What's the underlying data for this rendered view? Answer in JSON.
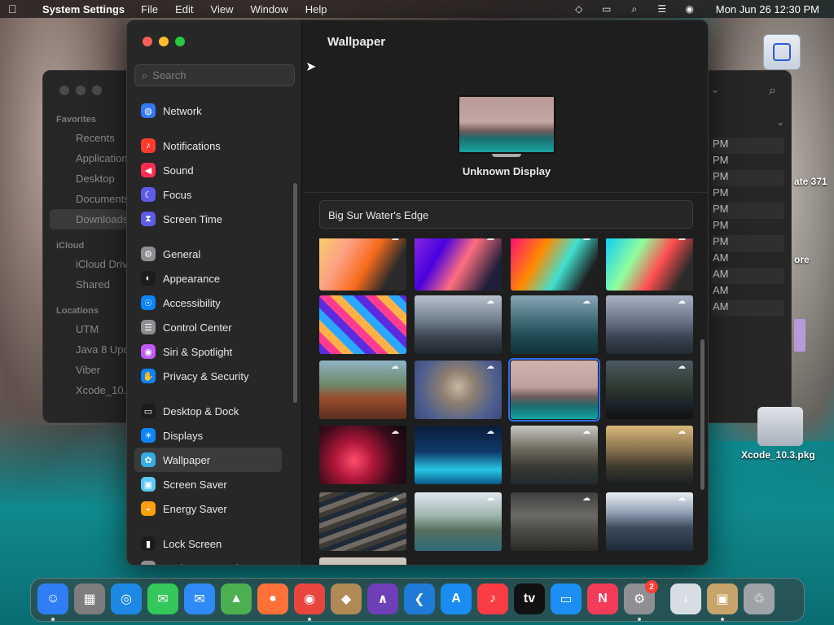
{
  "menubar": {
    "app_name": "System Settings",
    "menus": [
      "File",
      "Edit",
      "View",
      "Window",
      "Help"
    ],
    "clock": "Mon Jun 26  12:30 PM"
  },
  "finder": {
    "sidebar": {
      "favorites_label": "Favorites",
      "favorites": [
        "Recents",
        "Applications",
        "Desktop",
        "Documents",
        "Downloads"
      ],
      "icloud_label": "iCloud",
      "icloud": [
        "iCloud Drive",
        "Shared"
      ],
      "locations_label": "Locations",
      "locations": [
        "UTM",
        "Java 8 Update",
        "Viber",
        "Xcode_10.3"
      ]
    },
    "time_rows": [
      "PM",
      "PM",
      "PM",
      "PM",
      "PM",
      "PM",
      "PM",
      "AM",
      "AM",
      "AM",
      "AM"
    ]
  },
  "desktop": {
    "label1": "ate 371",
    "label2": "ore",
    "label3": "Xcode_10.3.pkg"
  },
  "settings": {
    "search_placeholder": "Search",
    "sidebar_items": [
      {
        "label": "Network",
        "icon": "globe-icon",
        "color": "#3478f6"
      },
      {
        "gap": true
      },
      {
        "label": "Notifications",
        "icon": "bell-icon",
        "color": "#ff3b30"
      },
      {
        "label": "Sound",
        "icon": "speaker-icon",
        "color": "#ff2d55"
      },
      {
        "label": "Focus",
        "icon": "moon-icon",
        "color": "#5e5ce6"
      },
      {
        "label": "Screen Time",
        "icon": "hourglass-icon",
        "color": "#5e5ce6"
      },
      {
        "gap": true
      },
      {
        "label": "General",
        "icon": "gear-icon",
        "color": "#8e8e93"
      },
      {
        "label": "Appearance",
        "icon": "appearance-icon",
        "color": "#1c1c1e"
      },
      {
        "label": "Accessibility",
        "icon": "accessibility-icon",
        "color": "#0a84ff"
      },
      {
        "label": "Control Center",
        "icon": "control-center-icon",
        "color": "#8e8e93"
      },
      {
        "label": "Siri & Spotlight",
        "icon": "siri-icon",
        "color": "#bf5af2"
      },
      {
        "label": "Privacy & Security",
        "icon": "hand-icon",
        "color": "#0a84ff"
      },
      {
        "gap": true
      },
      {
        "label": "Desktop & Dock",
        "icon": "dock-icon",
        "color": "#1c1c1e"
      },
      {
        "label": "Displays",
        "icon": "sun-icon",
        "color": "#0a84ff"
      },
      {
        "label": "Wallpaper",
        "icon": "flower-icon",
        "color": "#32ade6",
        "selected": true
      },
      {
        "label": "Screen Saver",
        "icon": "screensaver-icon",
        "color": "#5ac8fa"
      },
      {
        "label": "Energy Saver",
        "icon": "bulb-icon",
        "color": "#ff9f0a"
      },
      {
        "gap": true
      },
      {
        "label": "Lock Screen",
        "icon": "lock-icon",
        "color": "#1c1c1e"
      },
      {
        "label": "Login Password",
        "icon": "key-icon",
        "color": "#8e8e93"
      }
    ],
    "page_title": "Wallpaper",
    "display_name": "Unknown Display",
    "current_wallpaper": "Big Sur Water's Edge"
  },
  "dock": [
    {
      "name": "finder",
      "color": "#2f7ef6",
      "glyph": "☺",
      "running": true
    },
    {
      "name": "launchpad",
      "color": "#7d7d7d",
      "glyph": "▦"
    },
    {
      "name": "safari",
      "color": "#1e88e5",
      "glyph": "◎"
    },
    {
      "name": "messages",
      "color": "#34c759",
      "glyph": "✉"
    },
    {
      "name": "mail",
      "color": "#2f8af5",
      "glyph": "✉"
    },
    {
      "name": "maps",
      "color": "#4caf50",
      "glyph": "▲"
    },
    {
      "name": "firefox",
      "color": "#ff7139",
      "glyph": "●"
    },
    {
      "name": "chrome",
      "color": "#e8453c",
      "glyph": "◉",
      "running": true
    },
    {
      "name": "contacts",
      "color": "#b08954",
      "glyph": "◆"
    },
    {
      "name": "visual-studio",
      "color": "#6e3fb7",
      "glyph": "∧"
    },
    {
      "name": "vscode",
      "color": "#1f7bd8",
      "glyph": "❮"
    },
    {
      "name": "app-store",
      "color": "#1b8cf2",
      "glyph": "A"
    },
    {
      "name": "music",
      "color": "#fc3c44",
      "glyph": "♪"
    },
    {
      "name": "apple-tv",
      "color": "#111111",
      "glyph": "tv"
    },
    {
      "name": "keynote",
      "color": "#1d8ff2",
      "glyph": "▭"
    },
    {
      "name": "news",
      "color": "#f53b5a",
      "glyph": "N"
    },
    {
      "name": "system-settings",
      "color": "#8e8e93",
      "glyph": "⚙",
      "badge": "2",
      "running": true
    },
    {
      "name": "downloads-stack",
      "color": "#d8dde3",
      "glyph": "↓"
    },
    {
      "name": "installer",
      "color": "#c9a46a",
      "glyph": "▣",
      "running": true
    },
    {
      "name": "trash",
      "color": "#9ea3a8",
      "glyph": "♲"
    }
  ]
}
